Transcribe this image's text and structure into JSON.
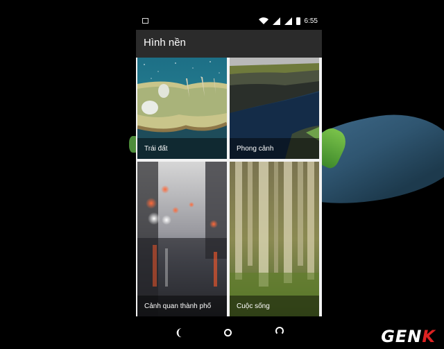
{
  "status_bar": {
    "time": "6:55",
    "icons": [
      "image-notification-icon",
      "wifi-icon",
      "signal-icon",
      "signal-icon",
      "battery-icon"
    ]
  },
  "app_bar": {
    "title": "Hình nền"
  },
  "wallpaper_categories": [
    {
      "label": "Trái đất"
    },
    {
      "label": "Phong cảnh"
    },
    {
      "label": "Cảnh quan thành phố"
    },
    {
      "label": "Cuộc sống"
    }
  ],
  "nav_bar": {
    "icons": [
      "back-icon",
      "home-icon",
      "recents-icon"
    ]
  },
  "watermark": {
    "text_main": "GEN",
    "text_accent": "K",
    "accent_color": "#d22222"
  },
  "colors": {
    "app_bar": "#2b2b2b",
    "background": "#000000"
  }
}
